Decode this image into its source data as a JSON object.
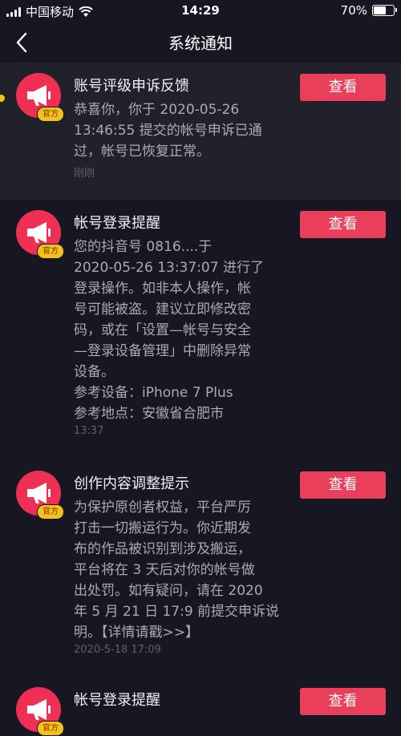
{
  "status_bar": {
    "carrier": "中国移动",
    "time": "14:29",
    "battery_pct": "70%",
    "battery_level": 0.7
  },
  "nav": {
    "title": "系统通知"
  },
  "notifications": [
    {
      "title": "账号评级申诉反馈",
      "badge": "官方",
      "button": "查看",
      "body": "恭喜你，你于 2020-05-26\n13:46:55 提交的帐号申诉已通\n过，帐号已恢复正常。",
      "time": "刚刚",
      "unread": true
    },
    {
      "title": "帐号登录提醒",
      "badge": "官方",
      "button": "查看",
      "body": "您的抖音号 0816....于\n2020-05-26 13:37:07 进行了\n登录操作。如非本人操作，帐\n号可能被盗。建议立即修改密\n码，或在「设置—帐号与安全\n—登录设备管理」中删除异常\n设备。\n参考设备：iPhone 7 Plus\n参考地点：安徽省合肥市",
      "time": "13:37"
    },
    {
      "title": "创作内容调整提示",
      "badge": "官方",
      "button": "查看",
      "body": "为保护原创者权益，平台严厉\n打击一切搬运行为。你近期发\n布的作品被识别到涉及搬运，\n平台将在 3 天后对你的帐号做\n出处罚。如有疑问，请在 2020\n年 5 月 21 日 17:9 前提交申诉说\n明。【详情请戳>>】",
      "time": "2020-5-18 17:09"
    },
    {
      "title": "帐号登录提醒",
      "badge": "官方",
      "button": "查看"
    }
  ]
}
